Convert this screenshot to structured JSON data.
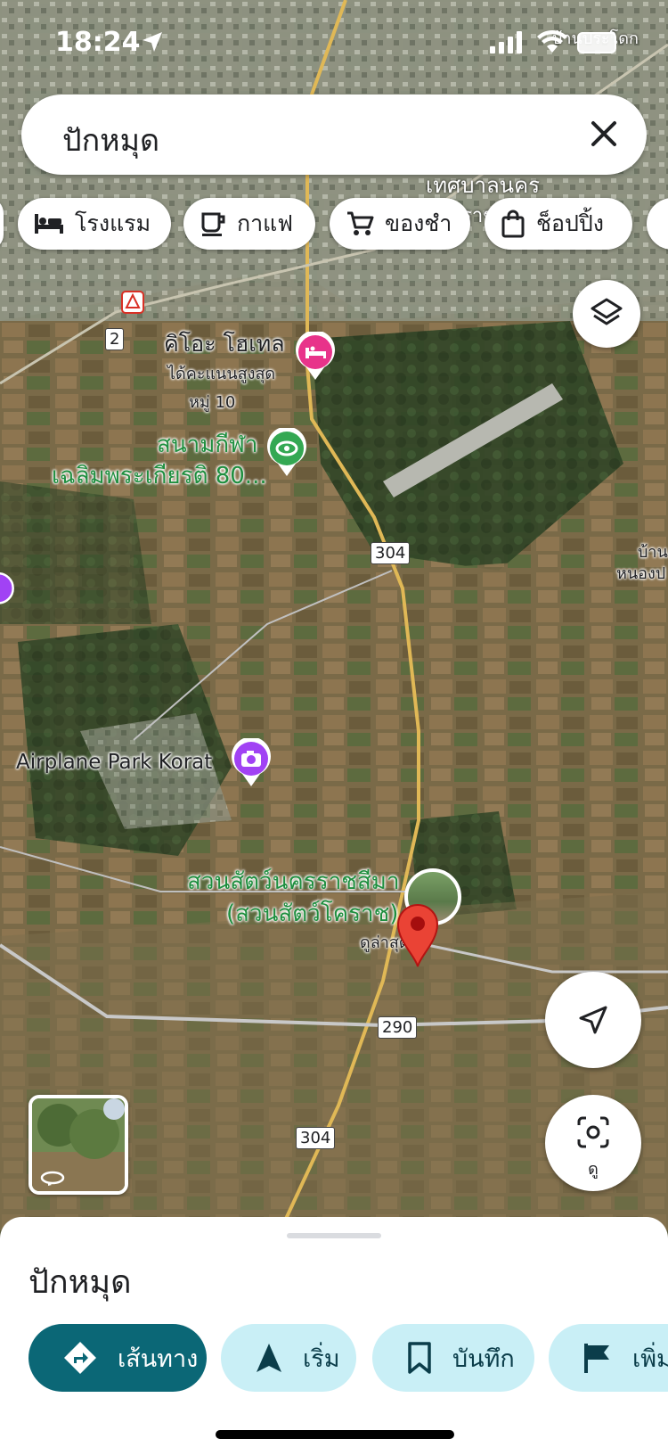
{
  "status_bar": {
    "time": "18:24"
  },
  "search": {
    "query": "ปักหมุด"
  },
  "chips": [
    {
      "label": "โรงแรม",
      "icon": "bed-icon"
    },
    {
      "label": "กาแฟ",
      "icon": "coffee-icon"
    },
    {
      "label": "ของชำ",
      "icon": "cart-icon"
    },
    {
      "label": "ช็อปปิ้ง",
      "icon": "shopping-bag-icon"
    }
  ],
  "map": {
    "labels": {
      "top_right_village": "บ้านประโดก",
      "municipality": "เทศบาลนคร",
      "ratcha": "ราช",
      "hotel_name": "คิโอะ โฮเทล",
      "hotel_sub": "ได้คะแนนสูงสุด",
      "moo": "หมู่ 10",
      "stadium_line1": "สนามกีฬา",
      "stadium_line2": "เฉลิมพระเกียรติ 80...",
      "right_village_1": "บ้าน",
      "right_village_2": "หนองป",
      "airplane_park": "Airplane Park Korat",
      "zoo_line1": "สวนสัตว์นครราชสีมา",
      "zoo_line2": "(สวนสัตว์โคราช)",
      "zoo_sub": "ดูล่าสุด"
    },
    "road_shields": [
      "2",
      "304",
      "290",
      "304"
    ],
    "look_label": "ดู"
  },
  "sheet": {
    "title": "ปักหมุด",
    "actions": [
      {
        "label": "เส้นทาง",
        "icon": "directions-icon"
      },
      {
        "label": "เริ่ม",
        "icon": "navigation-arrow-icon"
      },
      {
        "label": "บันทึก",
        "icon": "bookmark-icon"
      },
      {
        "label": "เพิ่มป้ายกำกับ",
        "icon": "flag-icon"
      }
    ]
  },
  "colors": {
    "primary_action": "#0b6776",
    "secondary_action": "#c9eff6",
    "pin": "#ea4335",
    "hotel_marker": "#e8338a",
    "park_marker": "#34a853",
    "attraction_marker": "#a142f4"
  }
}
